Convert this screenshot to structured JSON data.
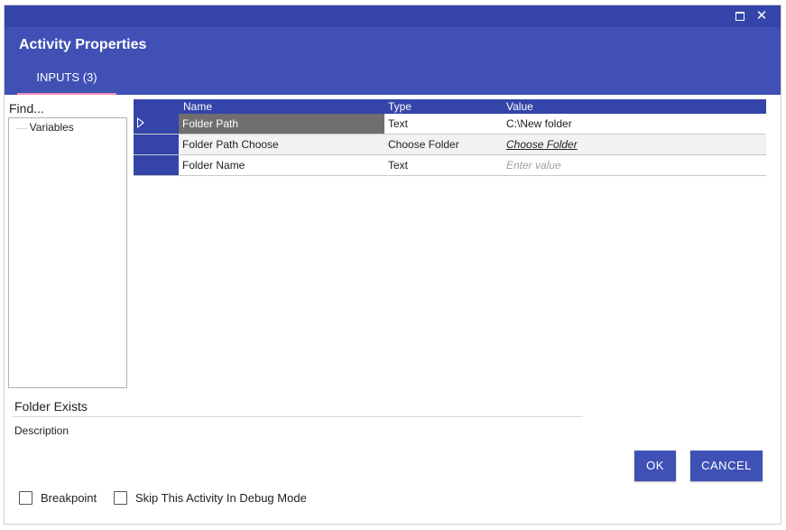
{
  "window": {
    "maximize_icon": "maximize-icon",
    "close_glyph": "✕"
  },
  "header": {
    "title": "Activity Properties",
    "tab_label": "INPUTS (3)"
  },
  "sidebar": {
    "find_label": "Find...",
    "tree_item": "Variables"
  },
  "grid": {
    "columns": {
      "name": "Name",
      "type": "Type",
      "value": "Value"
    },
    "rows": [
      {
        "name": "Folder Path",
        "type": "Text",
        "value": "C:\\New folder"
      },
      {
        "name": "Folder Path Choose",
        "type": "Choose Folder",
        "value": "Choose Folder"
      },
      {
        "name": "Folder Name",
        "type": "Text",
        "placeholder": "Enter value"
      }
    ]
  },
  "activity": {
    "name": "Folder Exists",
    "description_label": "Description"
  },
  "buttons": {
    "ok": "OK",
    "cancel": "CANCEL"
  },
  "options": {
    "breakpoint": "Breakpoint",
    "skip": "Skip This Activity In Debug Mode"
  },
  "colors": {
    "titlebar": "#3444a8",
    "header": "#4050b5",
    "tab_underline": "#f48fb1",
    "button": "#3f51b5",
    "selected_cell": "#6f6f6f"
  }
}
